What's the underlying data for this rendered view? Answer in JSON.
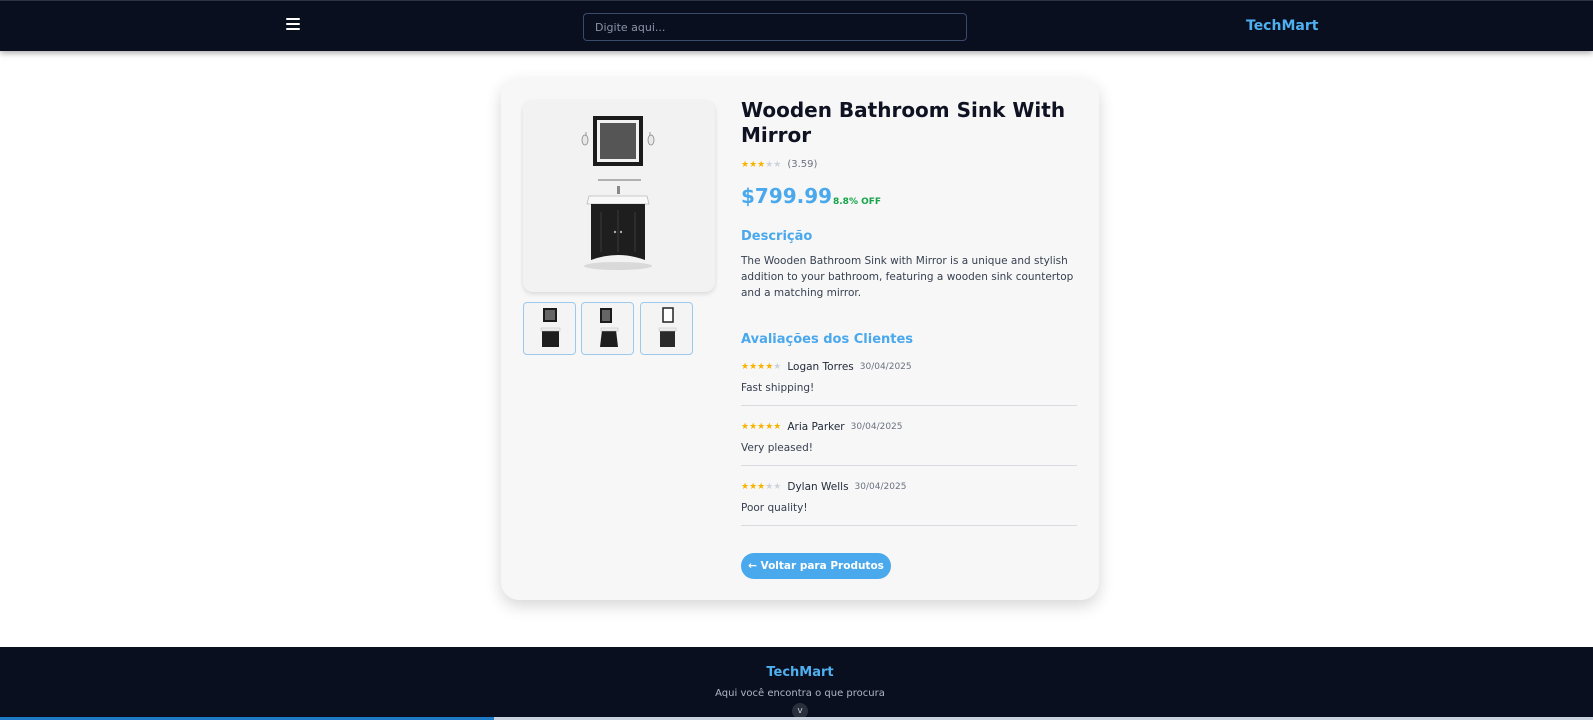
{
  "header": {
    "search_placeholder": "Digite aqui...",
    "brand": "TechMart",
    "menu_icon": "hamburger-menu-icon"
  },
  "product": {
    "title": "Wooden Bathroom Sink With Mirror",
    "rating": 3.59,
    "rating_text": "(3.59)",
    "price": "$799.99",
    "discount": "8.8% OFF",
    "description_title": "Descrição",
    "description": "The Wooden Bathroom Sink with Mirror is a unique and stylish addition to your bathroom, featuring a wooden sink countertop and a matching mirror.",
    "images_count": 3
  },
  "reviews": {
    "title": "Avaliações dos Clientes",
    "items": [
      {
        "name": "Logan Torres",
        "date": "30/04/2025",
        "rating": 4,
        "text": "Fast shipping!"
      },
      {
        "name": "Aria Parker",
        "date": "30/04/2025",
        "rating": 5,
        "text": "Very pleased!"
      },
      {
        "name": "Dylan Wells",
        "date": "30/04/2025",
        "rating": 3,
        "text": "Poor quality!"
      }
    ]
  },
  "actions": {
    "back_label": "←  Voltar para Produtos"
  },
  "footer": {
    "brand": "TechMart",
    "tagline": "Aqui você encontra o que procura",
    "chevron": "v"
  },
  "colors": {
    "accent": "#4aa8ec",
    "header_bg": "#0a0f1f",
    "discount_green": "#16a34a",
    "star_gold": "#f5b400"
  }
}
